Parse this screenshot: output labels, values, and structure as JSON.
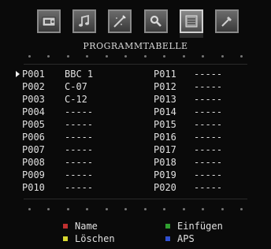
{
  "tabs": [
    {
      "icon": "picture-icon"
    },
    {
      "icon": "sound-icon"
    },
    {
      "icon": "feature-icon"
    },
    {
      "icon": "install-icon"
    },
    {
      "icon": "program-table-icon"
    },
    {
      "icon": "source-icon"
    }
  ],
  "title": "PROGRAMMTABELLE",
  "rows": [
    {
      "left_num": "P001",
      "left_name": "BBC 1",
      "right_num": "P011",
      "right_name": "-----"
    },
    {
      "left_num": "P002",
      "left_name": "C-07",
      "right_num": "P012",
      "right_name": "-----"
    },
    {
      "left_num": "P003",
      "left_name": "C-12",
      "right_num": "P013",
      "right_name": "-----"
    },
    {
      "left_num": "P004",
      "left_name": "-----",
      "right_num": "P014",
      "right_name": "-----"
    },
    {
      "left_num": "P005",
      "left_name": "-----",
      "right_num": "P015",
      "right_name": "-----"
    },
    {
      "left_num": "P006",
      "left_name": "-----",
      "right_num": "P016",
      "right_name": "-----"
    },
    {
      "left_num": "P007",
      "left_name": "-----",
      "right_num": "P017",
      "right_name": "-----"
    },
    {
      "left_num": "P008",
      "left_name": "-----",
      "right_num": "P018",
      "right_name": "-----"
    },
    {
      "left_num": "P009",
      "left_name": "-----",
      "right_num": "P019",
      "right_name": "-----"
    },
    {
      "left_num": "P010",
      "left_name": "-----",
      "right_num": "P020",
      "right_name": "-----"
    }
  ],
  "legend": {
    "name": {
      "label": "Name",
      "color": "#c03030"
    },
    "insert": {
      "label": "Einfügen",
      "color": "#30a030"
    },
    "delete": {
      "label": "Löschen",
      "color": "#d8d830"
    },
    "aps": {
      "label": "APS",
      "color": "#3050d0"
    }
  }
}
